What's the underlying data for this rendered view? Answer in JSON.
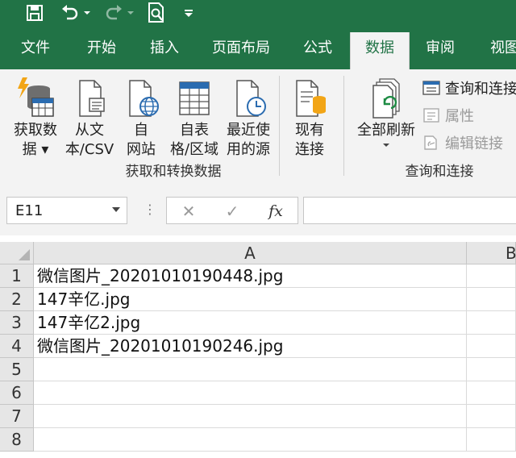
{
  "quick_access": {
    "save_icon": "save-icon",
    "undo_icon": "undo-icon",
    "redo_icon": "redo-icon",
    "print_preview_icon": "print-preview-icon",
    "customize_icon": "customize-qat-icon"
  },
  "tabs": [
    {
      "label": "文件",
      "active": false
    },
    {
      "label": "开始",
      "active": false
    },
    {
      "label": "插入",
      "active": false
    },
    {
      "label": "页面布局",
      "active": false
    },
    {
      "label": "公式",
      "active": false
    },
    {
      "label": "数据",
      "active": true
    },
    {
      "label": "审阅",
      "active": false
    },
    {
      "label": "视图",
      "active": false
    }
  ],
  "ribbon": {
    "get_transform": {
      "group_label": "获取和转换数据",
      "buttons": [
        {
          "label": "获取数\n据 ▾",
          "icon": "get-data-icon"
        },
        {
          "label": "从文\n本/CSV",
          "icon": "from-text-csv-icon"
        },
        {
          "label": "自\n网站",
          "icon": "from-web-icon"
        },
        {
          "label": "自表\n格/区域",
          "icon": "from-table-range-icon"
        },
        {
          "label": "最近使\n用的源",
          "icon": "recent-sources-icon"
        },
        {
          "label": "现有\n连接",
          "icon": "existing-connections-icon"
        }
      ]
    },
    "queries_connections": {
      "group_label": "查询和连接",
      "refresh_all": {
        "label": "全部刷新",
        "icon": "refresh-all-icon"
      },
      "small_buttons": [
        {
          "label": "查询和连接",
          "icon": "queries-connections-icon",
          "disabled": false
        },
        {
          "label": "属性",
          "icon": "properties-icon",
          "disabled": true
        },
        {
          "label": "编辑链接",
          "icon": "edit-links-icon",
          "disabled": true
        }
      ]
    }
  },
  "formula_bar": {
    "name_box": "E11",
    "cancel_symbol": "✕",
    "enter_symbol": "✓",
    "fx_symbol": "fx",
    "formula": ""
  },
  "sheet": {
    "columns": [
      "A",
      "B"
    ],
    "rows": [
      {
        "num": "1",
        "A": "微信图片_20201010190448.jpg"
      },
      {
        "num": "2",
        "A": "147辛亿.jpg"
      },
      {
        "num": "3",
        "A": "147辛亿2.jpg"
      },
      {
        "num": "4",
        "A": "微信图片_20201010190246.jpg"
      },
      {
        "num": "5",
        "A": ""
      },
      {
        "num": "6",
        "A": ""
      },
      {
        "num": "7",
        "A": ""
      },
      {
        "num": "8",
        "A": ""
      }
    ]
  },
  "colors": {
    "accent": "#217346",
    "ribbon_bg": "#f3f3f3",
    "header_bg": "#e6e6e6"
  }
}
